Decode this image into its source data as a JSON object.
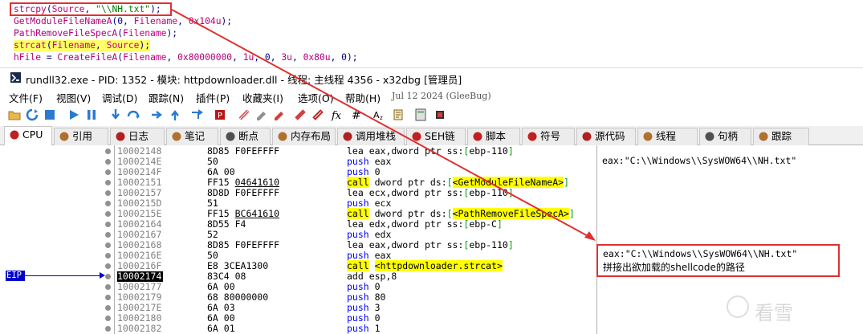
{
  "code_panel": {
    "lines": [
      [
        {
          "t": "strcpy",
          "c": "fn"
        },
        {
          "t": "(",
          "c": "punc"
        },
        {
          "t": "Source",
          "c": "var"
        },
        {
          "t": ", ",
          "c": "punc"
        },
        {
          "t": "\"\\\\NH.txt\"",
          "c": "str"
        },
        {
          "t": ");",
          "c": "punc"
        }
      ],
      [
        {
          "t": "GetModuleFileNameA",
          "c": "fn"
        },
        {
          "t": "(0, ",
          "c": "punc"
        },
        {
          "t": "Filename",
          "c": "var"
        },
        {
          "t": ", ",
          "c": "punc"
        },
        {
          "t": "0x104u",
          "c": "num"
        },
        {
          "t": ");",
          "c": "punc"
        }
      ],
      [
        {
          "t": "PathRemoveFileSpecA",
          "c": "fn"
        },
        {
          "t": "(",
          "c": "punc"
        },
        {
          "t": "Filename",
          "c": "var"
        },
        {
          "t": ");",
          "c": "punc"
        }
      ],
      [
        {
          "t": "strcat",
          "c": "fn"
        },
        {
          "t": "(",
          "c": "punc"
        },
        {
          "t": "Filename",
          "c": "var"
        },
        {
          "t": ", ",
          "c": "punc"
        },
        {
          "t": "Source",
          "c": "var"
        },
        {
          "t": ");",
          "c": "punc"
        }
      ],
      [
        {
          "t": "hFile",
          "c": "var"
        },
        {
          "t": " = ",
          "c": "punc"
        },
        {
          "t": "CreateFileA",
          "c": "fn"
        },
        {
          "t": "(",
          "c": "punc"
        },
        {
          "t": "Filename",
          "c": "var"
        },
        {
          "t": ", ",
          "c": "punc"
        },
        {
          "t": "0x80000000",
          "c": "num"
        },
        {
          "t": ", ",
          "c": "punc"
        },
        {
          "t": "1u",
          "c": "num"
        },
        {
          "t": ", 0, ",
          "c": "punc"
        },
        {
          "t": "3u",
          "c": "num"
        },
        {
          "t": ", ",
          "c": "punc"
        },
        {
          "t": "0x80u",
          "c": "num"
        },
        {
          "t": ", 0);",
          "c": "punc"
        }
      ]
    ]
  },
  "window": {
    "title": "rundll32.exe - PID: 1352 - 模块: httpdownloader.dll - 线程: 主线程 4356 - x32dbg [管理员]"
  },
  "menu": {
    "items": [
      "文件(F)",
      "视图(V)",
      "调试(D)",
      "跟踪(N)",
      "插件(P)",
      "收藏夹(I)",
      "选项(O)",
      "帮助(H)"
    ],
    "date": "Jul 12 2024 (GleeBug)"
  },
  "toolbar": {
    "icons": [
      "open-icon",
      "restart-icon",
      "stop-icon",
      "run-icon",
      "pause-icon",
      "step-into-icon",
      "step-over-icon",
      "trace-into-icon",
      "trace-over-icon",
      "execute-till-return-icon",
      "run-to-user-icon",
      "patch-icon",
      "comment-icon",
      "label-icon",
      "bookmark-icon",
      "function-icon",
      "hash-icon",
      "font-icon",
      "script-icon",
      "calculator-icon",
      "cpu-chip-icon",
      "graph-icon"
    ]
  },
  "tabs": [
    {
      "label": "CPU",
      "icon": "cpu-icon"
    },
    {
      "label": "引用",
      "icon": "references-icon"
    },
    {
      "label": "日志",
      "icon": "log-icon"
    },
    {
      "label": "笔记",
      "icon": "notes-icon"
    },
    {
      "label": "断点",
      "icon": "breakpoint-icon"
    },
    {
      "label": "内存布局",
      "icon": "memory-map-icon"
    },
    {
      "label": "调用堆栈",
      "icon": "call-stack-icon"
    },
    {
      "label": "SEH链",
      "icon": "seh-icon"
    },
    {
      "label": "脚本",
      "icon": "script-tab-icon"
    },
    {
      "label": "符号",
      "icon": "symbols-icon"
    },
    {
      "label": "源代码",
      "icon": "source-icon"
    },
    {
      "label": "线程",
      "icon": "threads-icon"
    },
    {
      "label": "句柄",
      "icon": "handles-icon"
    },
    {
      "label": "跟踪",
      "icon": "trace-icon"
    }
  ],
  "disasm": {
    "eip_label": "EIP",
    "rows": [
      {
        "addr": "10002148",
        "bytes": "8D85 F0FEFFFF",
        "asm": [
          [
            "lea",
            "m-lea"
          ],
          [
            " eax,dword ptr ss:",
            ""
          ],
          [
            "[",
            "brk"
          ],
          [
            "ebp-110",
            ""
          ],
          [
            "]",
            "brk"
          ]
        ]
      },
      {
        "addr": "1000214E",
        "bytes": "50",
        "asm": [
          [
            "push",
            "m-push"
          ],
          [
            " eax",
            ""
          ]
        ]
      },
      {
        "addr": "1000214F",
        "bytes": "6A 00",
        "asm": [
          [
            "push",
            "m-push"
          ],
          [
            " 0",
            ""
          ]
        ]
      },
      {
        "addr": "10002151",
        "bytes": "FF15 ",
        "bytes_u": "04641610",
        "asm": [
          [
            "call",
            "m-call"
          ],
          [
            " dword ptr ds:",
            ""
          ],
          [
            "[",
            "brk"
          ],
          [
            "<GetModuleFileNameA>",
            "target"
          ],
          [
            "]",
            "brk"
          ]
        ]
      },
      {
        "addr": "10002157",
        "bytes": "8D8D F0FEFFFF",
        "asm": [
          [
            "lea",
            "m-lea"
          ],
          [
            " ecx,dword ptr ss:",
            ""
          ],
          [
            "[",
            "brk"
          ],
          [
            "ebp-110",
            ""
          ],
          [
            "]",
            "brk"
          ]
        ]
      },
      {
        "addr": "1000215D",
        "bytes": "51",
        "asm": [
          [
            "push",
            "m-push"
          ],
          [
            " ecx",
            ""
          ]
        ]
      },
      {
        "addr": "1000215E",
        "bytes": "FF15 ",
        "bytes_u": "BC641610",
        "asm": [
          [
            "call",
            "m-call"
          ],
          [
            " dword ptr ds:",
            ""
          ],
          [
            "[",
            "brk"
          ],
          [
            "<PathRemoveFileSpecA>",
            "target"
          ],
          [
            "]",
            "brk"
          ]
        ]
      },
      {
        "addr": "10002164",
        "bytes": "8D55 F4",
        "asm": [
          [
            "lea",
            "m-lea"
          ],
          [
            " edx,dword ptr ss:",
            ""
          ],
          [
            "[",
            "brk"
          ],
          [
            "ebp-C",
            ""
          ],
          [
            "]",
            "brk"
          ]
        ]
      },
      {
        "addr": "10002167",
        "bytes": "52",
        "asm": [
          [
            "push",
            "m-push"
          ],
          [
            " edx",
            ""
          ]
        ]
      },
      {
        "addr": "10002168",
        "bytes": "8D85 F0FEFFFF",
        "asm": [
          [
            "lea",
            "m-lea"
          ],
          [
            " eax,dword ptr ss:",
            ""
          ],
          [
            "[",
            "brk"
          ],
          [
            "ebp-110",
            ""
          ],
          [
            "]",
            "brk"
          ]
        ]
      },
      {
        "addr": "1000216E",
        "bytes": "50",
        "asm": [
          [
            "push",
            "m-push"
          ],
          [
            " eax",
            ""
          ]
        ]
      },
      {
        "addr": "1000216F",
        "bytes": "E8 3CEA1300",
        "asm": [
          [
            "call",
            "m-call"
          ],
          [
            " ",
            ""
          ],
          [
            "<httpdownloader.strcat>",
            "target"
          ]
        ]
      },
      {
        "addr": "10002174",
        "bytes": "83C4 08",
        "asm": [
          [
            "add",
            "m-add"
          ],
          [
            " esp,8",
            ""
          ]
        ],
        "current": true
      },
      {
        "addr": "10002177",
        "bytes": "6A 00",
        "asm": [
          [
            "push",
            "m-push"
          ],
          [
            " 0",
            ""
          ]
        ]
      },
      {
        "addr": "10002179",
        "bytes": "68 80000000",
        "asm": [
          [
            "push",
            "m-push"
          ],
          [
            " 80",
            ""
          ]
        ]
      },
      {
        "addr": "1000217E",
        "bytes": "6A 03",
        "asm": [
          [
            "push",
            "m-push"
          ],
          [
            " 3",
            ""
          ]
        ]
      },
      {
        "addr": "10002180",
        "bytes": "6A 00",
        "asm": [
          [
            "push",
            "m-push"
          ],
          [
            " 0",
            ""
          ]
        ]
      },
      {
        "addr": "10002182",
        "bytes": "6A 01",
        "asm": [
          [
            "push",
            "m-push"
          ],
          [
            " 1",
            ""
          ]
        ]
      }
    ],
    "comment_top": "eax:\"C:\\\\Windows\\\\SysWOW64\\\\NH.txt\"",
    "comment_box_line1": "eax:\"C:\\\\Windows\\\\SysWOW64\\\\NH.txt\"",
    "comment_box_line2": "拼接出欲加载的shellcode的路径"
  },
  "watermark": "看雪",
  "colors": {
    "annotation_red": "#e03030",
    "eip_blue": "#0000cc",
    "call_yellow": "#ffff00"
  }
}
